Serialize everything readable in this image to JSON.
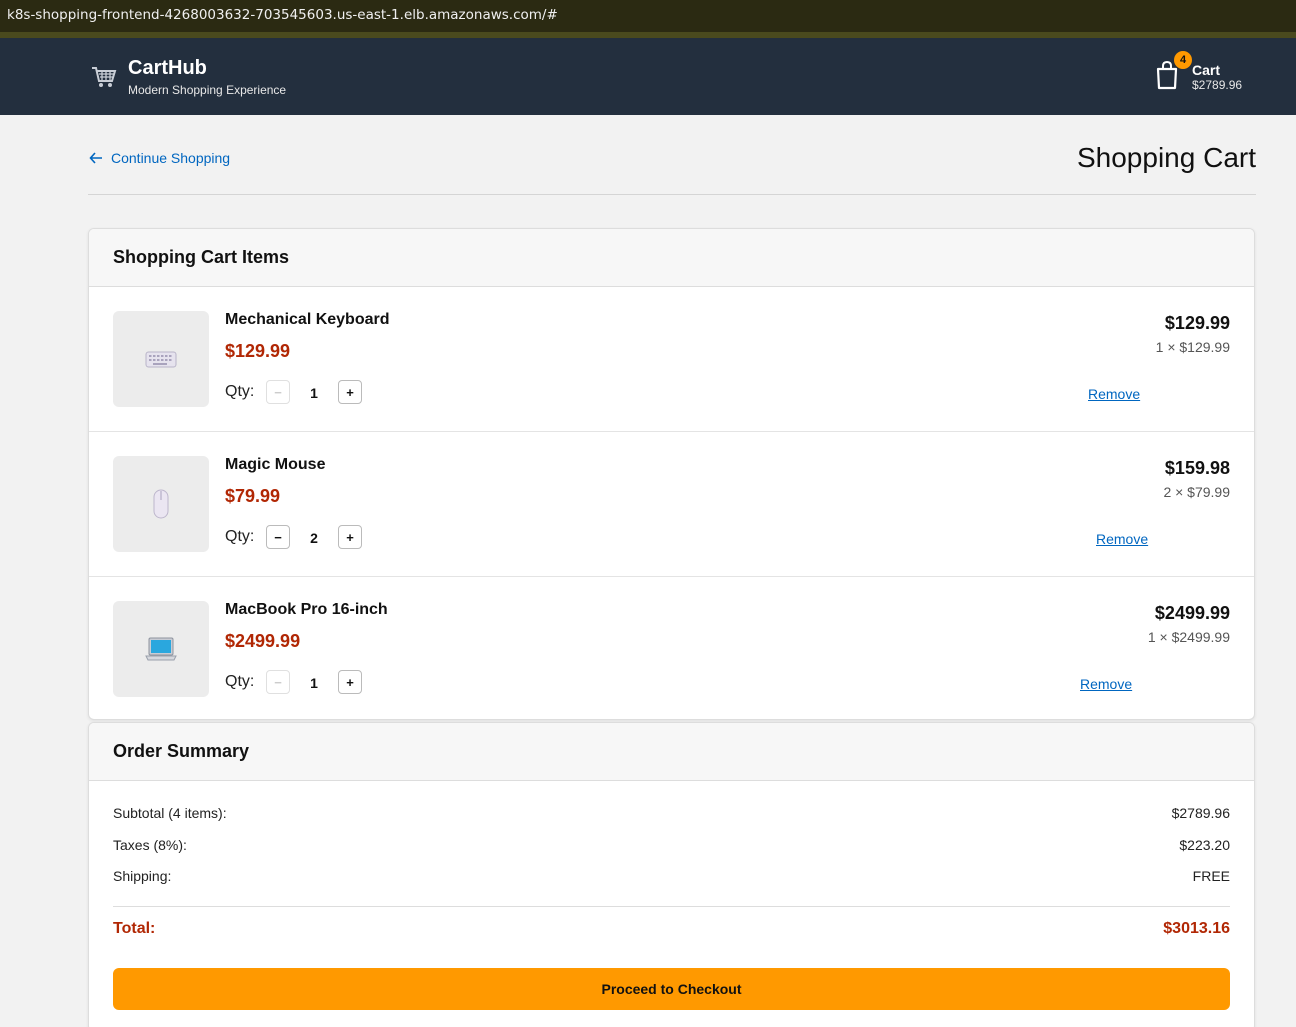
{
  "browser": {
    "url": "k8s-shopping-frontend-4268003632-703545603.us-east-1.elb.amazonaws.com/#"
  },
  "header": {
    "brand": "CartHub",
    "tagline": "Modern Shopping Experience",
    "logo_icon": "shopping-cart-icon",
    "cart": {
      "badge_count": "4",
      "label": "Cart",
      "total": "$2789.96",
      "icon": "shopping-bag-icon"
    }
  },
  "nav": {
    "back_label": "Continue Shopping",
    "page_title": "Shopping Cart"
  },
  "cart_items": {
    "heading": "Shopping Cart Items",
    "qty_label": "Qty:",
    "minus_label": "−",
    "plus_label": "+",
    "remove_label": "Remove",
    "items": [
      {
        "name": "Mechanical Keyboard",
        "price": "$129.99",
        "qty": "1",
        "line_total": "$129.99",
        "line_calc": "1 × $129.99",
        "icon": "keyboard-icon",
        "minus_disabled": true
      },
      {
        "name": "Magic Mouse",
        "price": "$79.99",
        "qty": "2",
        "line_total": "$159.98",
        "line_calc": "2 × $79.99",
        "icon": "mouse-icon",
        "minus_disabled": false
      },
      {
        "name": "MacBook Pro 16-inch",
        "price": "$2499.99",
        "qty": "1",
        "line_total": "$2499.99",
        "line_calc": "1 × $2499.99",
        "icon": "laptop-icon",
        "minus_disabled": true
      }
    ]
  },
  "summary": {
    "heading": "Order Summary",
    "subtotal_label": "Subtotal (4 items):",
    "subtotal_value": "$2789.96",
    "taxes_label": "Taxes (8%):",
    "taxes_value": "$223.20",
    "shipping_label": "Shipping:",
    "shipping_value": "FREE",
    "total_label": "Total:",
    "total_value": "$3013.16",
    "checkout_label": "Proceed to Checkout"
  },
  "colors": {
    "header_bg": "#232f3e",
    "accent": "#ff9900",
    "price_red": "#b12704",
    "link_blue": "#0066c0"
  }
}
